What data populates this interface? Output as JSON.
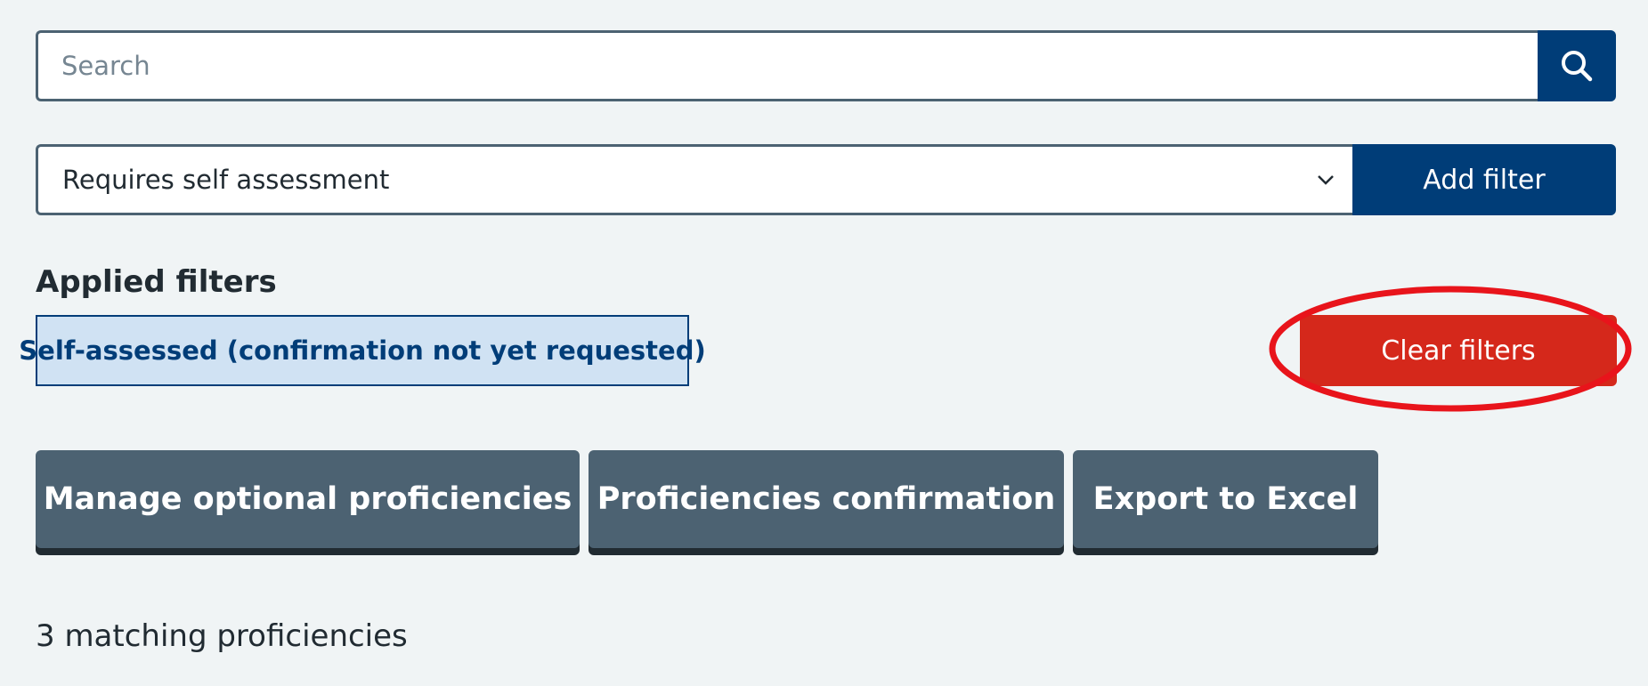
{
  "search": {
    "placeholder": "Search",
    "icon": "search-icon"
  },
  "filter": {
    "selected_value": "Requires self assessment",
    "add_button_label": "Add filter",
    "chevron_icon": "chevron-down-icon"
  },
  "applied_filters": {
    "heading": "Applied filters",
    "tags": [
      "Self-assessed (confirmation not yet requested)"
    ],
    "clear_button_label": "Clear filters"
  },
  "actions": [
    {
      "label": "Manage optional proficiencies"
    },
    {
      "label": "Proficiencies confirmation"
    },
    {
      "label": "Export to Excel"
    }
  ],
  "results": {
    "count_text": "3 matching proficiencies"
  },
  "colors": {
    "background": "#f0f4f5",
    "primary_blue": "#003d78",
    "secondary_grey": "#4c6272",
    "danger_red": "#d5281b",
    "tag_background": "#d0e2f3",
    "highlight_annotation": "#e8141b"
  }
}
